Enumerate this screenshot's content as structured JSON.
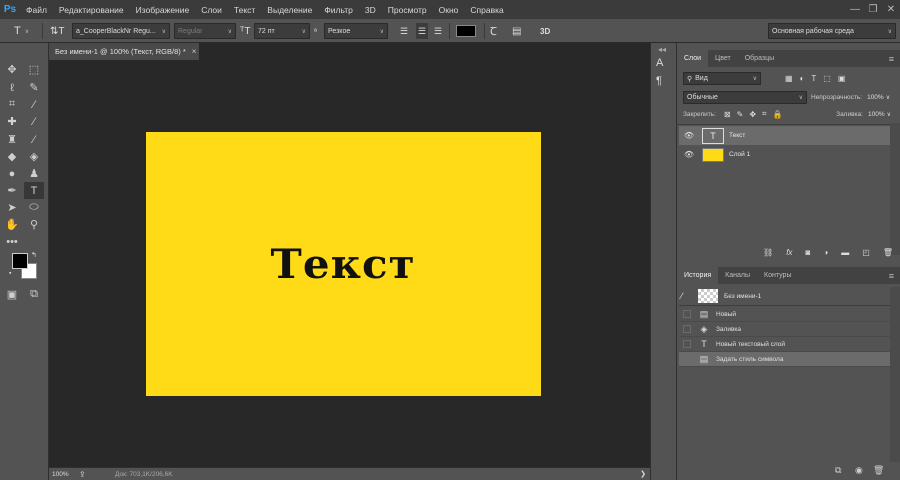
{
  "app": {
    "logo": "Ps"
  },
  "menu": [
    "Файл",
    "Редактирование",
    "Изображение",
    "Слои",
    "Текст",
    "Выделение",
    "Фильтр",
    "3D",
    "Просмотр",
    "Окно",
    "Справка"
  ],
  "window_controls": [
    "—",
    "❐",
    "✕"
  ],
  "options": {
    "tool_glyph": "T",
    "font_family": "a_CooperBlackNr Regu...",
    "font_style": "Regular",
    "font_size": "72 пт",
    "antialias": "Резкое",
    "color": "#000000",
    "threed": "3D",
    "workspace": "Основная рабочая среда"
  },
  "document": {
    "tab_title": "Без имени-1 @ 100% (Текст, RGB/8) *",
    "canvas_color": "#fedb16",
    "canvas_text": "Текст",
    "zoom": "100%",
    "doc_info": "Док: 703,1K/206,6K"
  },
  "layers_panel": {
    "tabs": [
      "Слои",
      "Цвет",
      "Образцы"
    ],
    "filter_label": "Вид",
    "blend_mode": "Обычные",
    "opacity_label": "Непрозрачность:",
    "opacity_value": "100%",
    "lock_label": "Закрепить:",
    "fill_label": "Заливка:",
    "fill_value": "100%",
    "layers": [
      {
        "name": "Текст",
        "type": "text",
        "selected": true
      },
      {
        "name": "Слой 1",
        "type": "fill",
        "color": "#fedb16",
        "selected": false
      }
    ],
    "footer_icons": [
      "link-icon",
      "fx-icon",
      "mask-icon",
      "adjustment-icon",
      "folder-icon",
      "new-layer-icon",
      "trash-icon"
    ]
  },
  "history_panel": {
    "tabs": [
      "История",
      "Каналы",
      "Контуры"
    ],
    "snapshot": "Без имени-1",
    "items": [
      {
        "label": "Новый",
        "icon": "document-icon"
      },
      {
        "label": "Заливка",
        "icon": "paint-bucket-icon"
      },
      {
        "label": "Новый текстовый слой",
        "icon": "text-icon"
      },
      {
        "label": "Задать стиль символа",
        "icon": "document-icon",
        "selected": true
      }
    ]
  }
}
